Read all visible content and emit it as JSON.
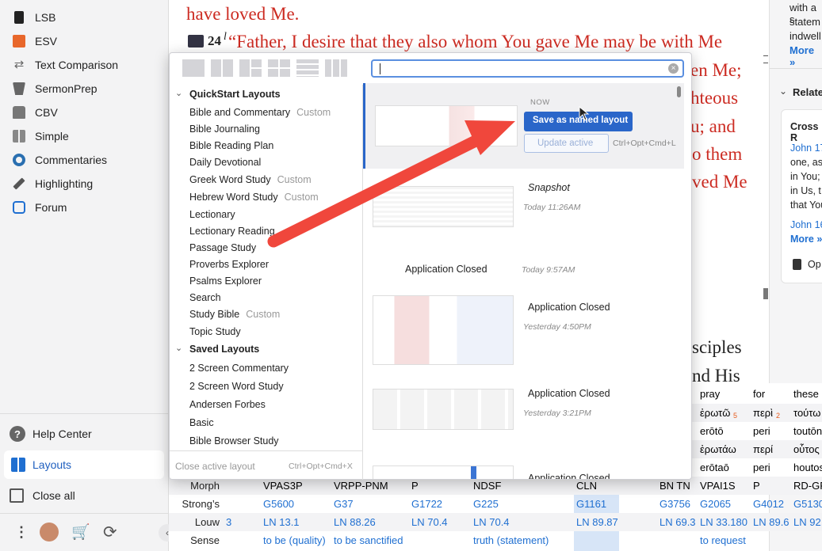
{
  "sidebar": {
    "items": [
      {
        "label": "LSB",
        "icon": "book-icon"
      },
      {
        "label": "ESV",
        "icon": "book-orange-icon"
      },
      {
        "label": "Text Comparison",
        "icon": "compare-arrows-icon"
      },
      {
        "label": "SermonPrep",
        "icon": "podium-icon"
      },
      {
        "label": "CBV",
        "icon": "open-book-icon"
      },
      {
        "label": "Simple",
        "icon": "grid-icon"
      },
      {
        "label": "Commentaries",
        "icon": "commentary-icon"
      },
      {
        "label": "Highlighting",
        "icon": "pen-icon"
      },
      {
        "label": "Forum",
        "icon": "forum-icon"
      }
    ],
    "help_center": "Help Center",
    "layouts": "Layouts",
    "close_all": "Close all"
  },
  "bible": {
    "line1": "have loved Me.",
    "verse_num": "24",
    "verse_marker": "l",
    "line2": "“Father, I desire that they also whom You gave Me may be with Me",
    "frag1": "en Me;",
    "frag2": "hteous",
    "frag3": "u; and",
    "frag4": "o them",
    "frag5": "ved Me",
    "frag6": "sciples",
    "frag7": "nd His"
  },
  "right_panel": {
    "text1": "with a s",
    "text2": "statem",
    "text3": "indwell",
    "more1": "More »",
    "related": "Relate",
    "cross": "Cross R",
    "john1": "John 17",
    "t1": "one, as",
    "t2": "in You;",
    "t3": "in Us, t",
    "t4": "that You",
    "john2": "John 16",
    "more2": "More »",
    "op": "Op"
  },
  "popup": {
    "search_value": "",
    "sections": {
      "quickstart": "QuickStart Layouts",
      "saved": "Saved Layouts"
    },
    "quickstart_items": [
      {
        "label": "Bible and Commentary",
        "tag": "Custom"
      },
      {
        "label": "Bible Journaling",
        "tag": ""
      },
      {
        "label": "Bible Reading Plan",
        "tag": ""
      },
      {
        "label": "Daily Devotional",
        "tag": ""
      },
      {
        "label": "Greek Word Study",
        "tag": "Custom"
      },
      {
        "label": "Hebrew Word Study",
        "tag": "Custom"
      },
      {
        "label": "Lectionary",
        "tag": ""
      },
      {
        "label": "Lectionary Reading",
        "tag": ""
      },
      {
        "label": "Passage Study",
        "tag": ""
      },
      {
        "label": "Proverbs Explorer",
        "tag": ""
      },
      {
        "label": "Psalms Explorer",
        "tag": ""
      },
      {
        "label": "Search",
        "tag": ""
      },
      {
        "label": "Study Bible",
        "tag": "Custom"
      },
      {
        "label": "Topic Study",
        "tag": ""
      }
    ],
    "saved_items": [
      "2 Screen Commentary",
      "2 Screen Word Study",
      "Andersen Forbes",
      "Basic",
      "Bible Browser Study"
    ],
    "close_active": "Close active layout",
    "close_shortcut": "Ctrl+Opt+Cmd+X",
    "now_label": "NOW",
    "save_named": "Save as named layout",
    "update_active": "Update active",
    "update_shortcut": "Ctrl+Opt+Cmd+L",
    "entries": [
      {
        "title": "Snapshot",
        "time": "Today 11:26AM"
      },
      {
        "title": "Application Closed",
        "time": "Today 9:57AM"
      },
      {
        "title": "Application Closed",
        "time": "Yesterday 4:50PM"
      },
      {
        "title": "Application Closed",
        "time": "Yesterday 3:21PM"
      },
      {
        "title": "Application Closed",
        "time": ""
      }
    ]
  },
  "table": {
    "top_rows": [
      [
        "pray",
        "for",
        "these"
      ],
      [
        "ἐρωτῶ",
        "περὶ",
        "τούτω"
      ],
      [
        "erōtō",
        "peri",
        "toutōn"
      ],
      [
        "ἐρωτάω",
        "περί",
        "οὗτος"
      ],
      [
        "erōtaō",
        "peri",
        "houtos"
      ]
    ],
    "top_sups": [
      "5",
      "2"
    ],
    "morph_label": "Morph",
    "morph": [
      "VPAS3P",
      "VRPP-PNM",
      "P",
      "NDSF",
      "CLN",
      "BN TN",
      "VPAI1S",
      "P",
      "RD-GP"
    ],
    "strongs_label": "Strong’s",
    "strongs": [
      "G5600",
      "G37",
      "G1722",
      "G225",
      "G1161",
      "G3756",
      "G2065",
      "G4012",
      "G5130"
    ],
    "louw_label": "Louw",
    "louw_prefix": "3",
    "louw": [
      "LN 13.1",
      "LN 88.26",
      "LN 70.4",
      "LN 70.4",
      "LN 89.87",
      "LN 69.3",
      "LN 33.180",
      "LN 89.6",
      "LN 92."
    ],
    "sense_label": "Sense",
    "sense": [
      "to be (quality)",
      "to be sanctified",
      "truth (statement)",
      "to request"
    ]
  },
  "colors": {
    "accent": "#2a66c9",
    "bible_red": "#cc2b22",
    "arrow": "#f0473c"
  }
}
